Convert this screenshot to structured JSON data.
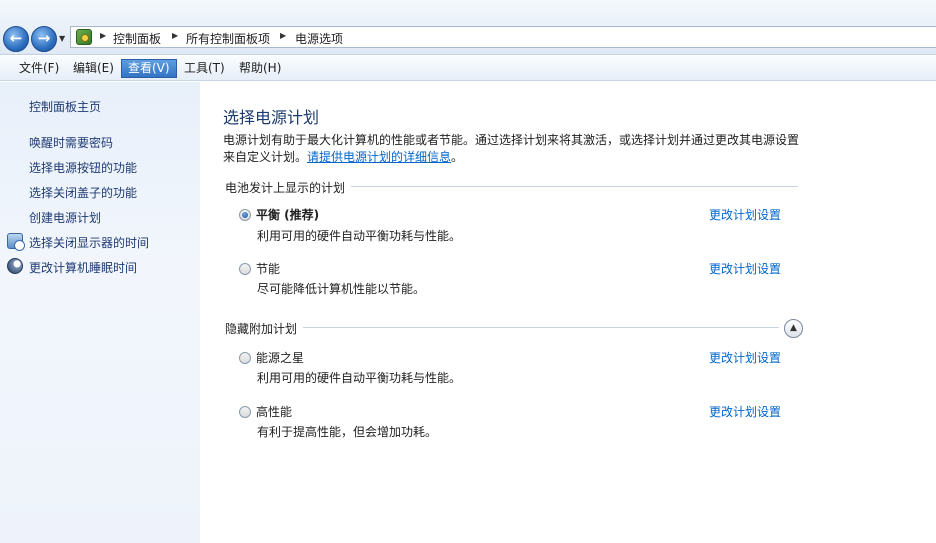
{
  "address": {
    "crumbs": [
      "控制面板",
      "所有控制面板项",
      "电源选项"
    ]
  },
  "menu": {
    "items": [
      "文件(F)",
      "编辑(E)",
      "查看(V)",
      "工具(T)",
      "帮助(H)"
    ],
    "active": "查看(V)"
  },
  "sidebar": {
    "home": "控制面板主页",
    "tasks": [
      "唤醒时需要密码",
      "选择电源按钮的功能",
      "选择关闭盖子的功能",
      "创建电源计划",
      "选择关闭显示器的时间",
      "更改计算机睡眠时间"
    ]
  },
  "main": {
    "title": "选择电源计划",
    "desc_line1": "电源计划有助于最大化计算机的性能或者节能。通过选择计划来将其激活，或选择计划并通过更改其电源设置",
    "desc_line2_prefix": "来自定义计划。",
    "desc_link": "请提供电源计划的详细信息",
    "desc_line2_suffix": "。",
    "battery_section": "电池发计上显示的计划",
    "hidden_section": "隐藏附加计划",
    "change_link": "更改计划设置",
    "plans": [
      {
        "name": "平衡 (推荐)",
        "desc": "利用可用的硬件自动平衡功耗与性能。",
        "selected": true
      },
      {
        "name": "节能",
        "desc": "尽可能降低计算机性能以节能。",
        "selected": false
      },
      {
        "name": "能源之星",
        "desc": "利用可用的硬件自动平衡功耗与性能。",
        "selected": false
      },
      {
        "name": "高性能",
        "desc": "有利于提高性能，但会增加功耗。",
        "selected": false
      }
    ]
  },
  "icons": {
    "back": "back-arrow-icon",
    "forward": "forward-arrow-icon",
    "control_panel": "control-panel-icon",
    "monitor": "monitor-clock-icon",
    "sleep": "moon-icon",
    "collapse": "chevron-up-icon"
  }
}
